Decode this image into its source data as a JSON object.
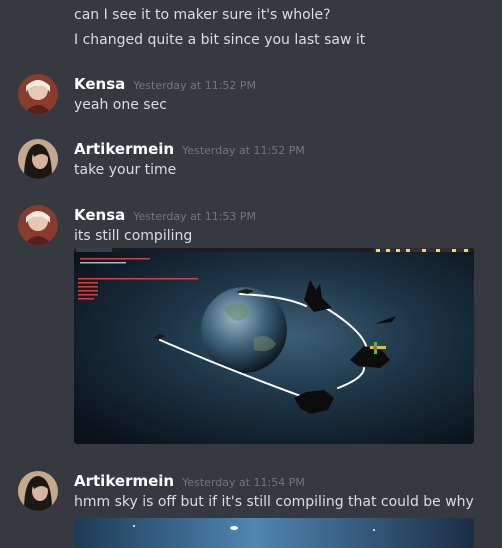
{
  "messages": {
    "m0": {
      "lines": [
        "can I see it to maker sure it's whole?",
        "I changed quite a bit since you last saw it"
      ]
    },
    "m1": {
      "author": "Kensa",
      "time": "Yesterday at 11:52 PM",
      "text": "yeah one sec"
    },
    "m2": {
      "author": "Artikermein",
      "time": "Yesterday at 11:52 PM",
      "text": "take your time"
    },
    "m3": {
      "author": "Kensa",
      "time": "Yesterday at 11:53 PM",
      "text": "its still compiling"
    },
    "m4": {
      "author": "Artikermein",
      "time": "Yesterday at 11:54 PM",
      "text": "hmm sky is off but if it's still compiling that could be why"
    }
  },
  "colors": {
    "background": "#36393f",
    "username": "#ffffff",
    "timestamp": "#72767d",
    "message_text": "#dcddde"
  }
}
